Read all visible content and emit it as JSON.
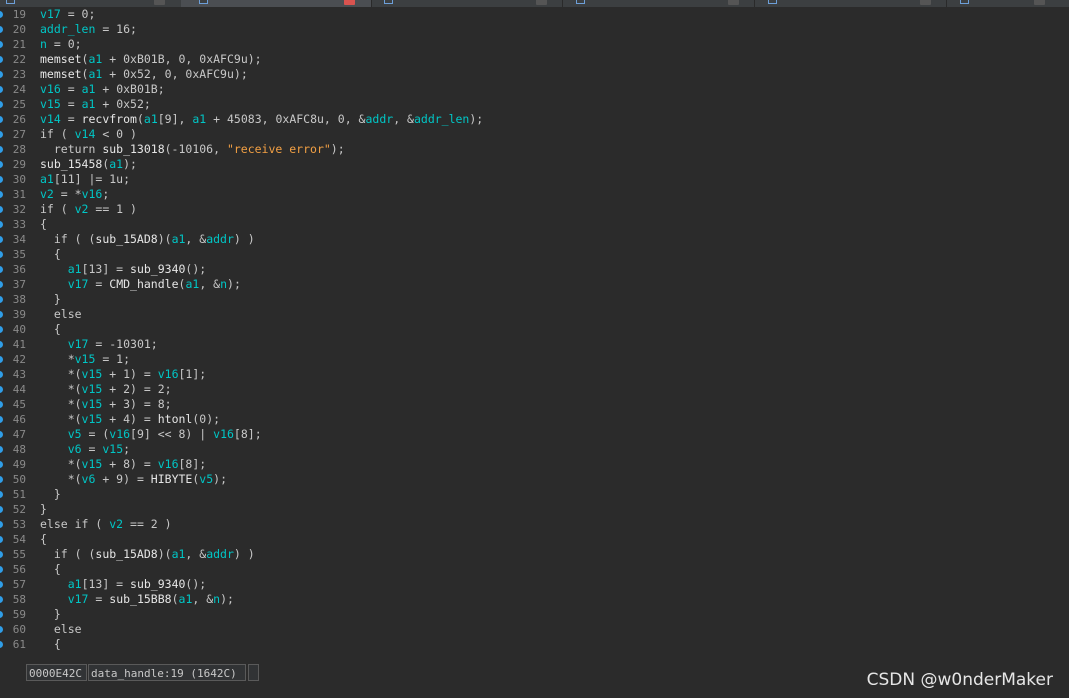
{
  "editor": {
    "lines": [
      {
        "n": "19",
        "tokens": [
          [
            "id",
            "v17"
          ],
          [
            "p",
            " = 0;"
          ]
        ]
      },
      {
        "n": "20",
        "tokens": [
          [
            "id",
            "addr_len"
          ],
          [
            "p",
            " = 16;"
          ]
        ]
      },
      {
        "n": "21",
        "tokens": [
          [
            "id",
            "n"
          ],
          [
            "p",
            " = 0;"
          ]
        ]
      },
      {
        "n": "22",
        "tokens": [
          [
            "fn",
            "memset"
          ],
          [
            "p",
            "("
          ],
          [
            "id",
            "a1"
          ],
          [
            "p",
            " + 0xB01B, 0, 0xAFC9u);"
          ]
        ]
      },
      {
        "n": "23",
        "tokens": [
          [
            "fn",
            "memset"
          ],
          [
            "p",
            "("
          ],
          [
            "id",
            "a1"
          ],
          [
            "p",
            " + 0x52, 0, 0xAFC9u);"
          ]
        ]
      },
      {
        "n": "24",
        "tokens": [
          [
            "id",
            "v16"
          ],
          [
            "p",
            " = "
          ],
          [
            "id",
            "a1"
          ],
          [
            "p",
            " + 0xB01B;"
          ]
        ]
      },
      {
        "n": "25",
        "tokens": [
          [
            "id",
            "v15"
          ],
          [
            "p",
            " = "
          ],
          [
            "id",
            "a1"
          ],
          [
            "p",
            " + 0x52;"
          ]
        ]
      },
      {
        "n": "26",
        "tokens": [
          [
            "id",
            "v14"
          ],
          [
            "p",
            " = "
          ],
          [
            "fn",
            "recvfrom"
          ],
          [
            "p",
            "("
          ],
          [
            "id",
            "a1"
          ],
          [
            "p",
            "[9], "
          ],
          [
            "id",
            "a1"
          ],
          [
            "p",
            " + 45083, 0xAFC8u, 0, &"
          ],
          [
            "id",
            "addr"
          ],
          [
            "p",
            ", &"
          ],
          [
            "id",
            "addr_len"
          ],
          [
            "p",
            ");"
          ]
        ]
      },
      {
        "n": "27",
        "tokens": [
          [
            "p",
            "if ( "
          ],
          [
            "id",
            "v14"
          ],
          [
            "p",
            " < 0 )"
          ]
        ]
      },
      {
        "n": "28",
        "tokens": [
          [
            "p",
            "  return "
          ],
          [
            "fn",
            "sub_13018"
          ],
          [
            "p",
            "(-10106, "
          ],
          [
            "str",
            "\"receive error\""
          ],
          [
            "p",
            ");"
          ]
        ]
      },
      {
        "n": "29",
        "tokens": [
          [
            "fn",
            "sub_15458"
          ],
          [
            "p",
            "("
          ],
          [
            "id",
            "a1"
          ],
          [
            "p",
            ");"
          ]
        ]
      },
      {
        "n": "30",
        "tokens": [
          [
            "id",
            "a1"
          ],
          [
            "p",
            "[11] |= 1u;"
          ]
        ]
      },
      {
        "n": "31",
        "tokens": [
          [
            "id",
            "v2"
          ],
          [
            "p",
            " = *"
          ],
          [
            "id",
            "v16"
          ],
          [
            "p",
            ";"
          ]
        ]
      },
      {
        "n": "32",
        "tokens": [
          [
            "p",
            "if ( "
          ],
          [
            "id",
            "v2"
          ],
          [
            "p",
            " == 1 )"
          ]
        ]
      },
      {
        "n": "33",
        "tokens": [
          [
            "p",
            "{"
          ]
        ]
      },
      {
        "n": "34",
        "tokens": [
          [
            "p",
            "  if ( ("
          ],
          [
            "fn",
            "sub_15AD8"
          ],
          [
            "p",
            ")("
          ],
          [
            "id",
            "a1"
          ],
          [
            "p",
            ", &"
          ],
          [
            "id",
            "addr"
          ],
          [
            "p",
            ") )"
          ]
        ]
      },
      {
        "n": "35",
        "tokens": [
          [
            "p",
            "  {"
          ]
        ]
      },
      {
        "n": "36",
        "tokens": [
          [
            "p",
            "    "
          ],
          [
            "id",
            "a1"
          ],
          [
            "p",
            "[13] = "
          ],
          [
            "fn",
            "sub_9340"
          ],
          [
            "p",
            "();"
          ]
        ]
      },
      {
        "n": "37",
        "tokens": [
          [
            "p",
            "    "
          ],
          [
            "id",
            "v17"
          ],
          [
            "p",
            " = "
          ],
          [
            "fn",
            "CMD_handle"
          ],
          [
            "p",
            "("
          ],
          [
            "id",
            "a1"
          ],
          [
            "p",
            ", &"
          ],
          [
            "id",
            "n"
          ],
          [
            "p",
            ");"
          ]
        ]
      },
      {
        "n": "38",
        "tokens": [
          [
            "p",
            "  }"
          ]
        ]
      },
      {
        "n": "39",
        "tokens": [
          [
            "p",
            "  else"
          ]
        ]
      },
      {
        "n": "40",
        "tokens": [
          [
            "p",
            "  {"
          ]
        ]
      },
      {
        "n": "41",
        "tokens": [
          [
            "p",
            "    "
          ],
          [
            "id",
            "v17"
          ],
          [
            "p",
            " = -10301;"
          ]
        ]
      },
      {
        "n": "42",
        "tokens": [
          [
            "p",
            "    *"
          ],
          [
            "id",
            "v15"
          ],
          [
            "p",
            " = 1;"
          ]
        ]
      },
      {
        "n": "43",
        "tokens": [
          [
            "p",
            "    *("
          ],
          [
            "id",
            "v15"
          ],
          [
            "p",
            " + 1) = "
          ],
          [
            "id",
            "v16"
          ],
          [
            "p",
            "[1];"
          ]
        ]
      },
      {
        "n": "44",
        "tokens": [
          [
            "p",
            "    *("
          ],
          [
            "id",
            "v15"
          ],
          [
            "p",
            " + 2) = 2;"
          ]
        ]
      },
      {
        "n": "45",
        "tokens": [
          [
            "p",
            "    *("
          ],
          [
            "id",
            "v15"
          ],
          [
            "p",
            " + 3) = 8;"
          ]
        ]
      },
      {
        "n": "46",
        "tokens": [
          [
            "p",
            "    *("
          ],
          [
            "id",
            "v15"
          ],
          [
            "p",
            " + 4) = "
          ],
          [
            "fn",
            "htonl"
          ],
          [
            "p",
            "(0);"
          ]
        ]
      },
      {
        "n": "47",
        "tokens": [
          [
            "p",
            "    "
          ],
          [
            "id",
            "v5"
          ],
          [
            "p",
            " = ("
          ],
          [
            "id",
            "v16"
          ],
          [
            "p",
            "[9] << 8) | "
          ],
          [
            "id",
            "v16"
          ],
          [
            "p",
            "[8];"
          ]
        ]
      },
      {
        "n": "48",
        "tokens": [
          [
            "p",
            "    "
          ],
          [
            "id",
            "v6"
          ],
          [
            "p",
            " = "
          ],
          [
            "id",
            "v15"
          ],
          [
            "p",
            ";"
          ]
        ]
      },
      {
        "n": "49",
        "tokens": [
          [
            "p",
            "    *("
          ],
          [
            "id",
            "v15"
          ],
          [
            "p",
            " + 8) = "
          ],
          [
            "id",
            "v16"
          ],
          [
            "p",
            "[8];"
          ]
        ]
      },
      {
        "n": "50",
        "tokens": [
          [
            "p",
            "    *("
          ],
          [
            "id",
            "v6"
          ],
          [
            "p",
            " + 9) = "
          ],
          [
            "fn",
            "HIBYTE"
          ],
          [
            "p",
            "("
          ],
          [
            "id",
            "v5"
          ],
          [
            "p",
            ");"
          ]
        ]
      },
      {
        "n": "51",
        "tokens": [
          [
            "p",
            "  }"
          ]
        ]
      },
      {
        "n": "52",
        "tokens": [
          [
            "p",
            "}"
          ]
        ]
      },
      {
        "n": "53",
        "tokens": [
          [
            "p",
            "else if ( "
          ],
          [
            "id",
            "v2"
          ],
          [
            "p",
            " == 2 )"
          ]
        ]
      },
      {
        "n": "54",
        "tokens": [
          [
            "p",
            "{"
          ]
        ]
      },
      {
        "n": "55",
        "tokens": [
          [
            "p",
            "  if ( ("
          ],
          [
            "fn",
            "sub_15AD8"
          ],
          [
            "p",
            ")("
          ],
          [
            "id",
            "a1"
          ],
          [
            "p",
            ", &"
          ],
          [
            "id",
            "addr"
          ],
          [
            "p",
            ") )"
          ]
        ]
      },
      {
        "n": "56",
        "tokens": [
          [
            "p",
            "  {"
          ]
        ]
      },
      {
        "n": "57",
        "tokens": [
          [
            "p",
            "    "
          ],
          [
            "id",
            "a1"
          ],
          [
            "p",
            "[13] = "
          ],
          [
            "fn",
            "sub_9340"
          ],
          [
            "p",
            "();"
          ]
        ]
      },
      {
        "n": "58",
        "tokens": [
          [
            "p",
            "    "
          ],
          [
            "id",
            "v17"
          ],
          [
            "p",
            " = "
          ],
          [
            "fn",
            "sub_15BB8"
          ],
          [
            "p",
            "("
          ],
          [
            "id",
            "a1"
          ],
          [
            "p",
            ", &"
          ],
          [
            "id",
            "n"
          ],
          [
            "p",
            ");"
          ]
        ]
      },
      {
        "n": "59",
        "tokens": [
          [
            "p",
            "  }"
          ]
        ]
      },
      {
        "n": "60",
        "tokens": [
          [
            "p",
            "  else"
          ]
        ]
      },
      {
        "n": "61",
        "tokens": [
          [
            "p",
            "  {"
          ]
        ]
      }
    ]
  },
  "status": {
    "address": "0000E42C",
    "location": "data_handle:19 (1642C)",
    "extra": ""
  },
  "watermark": "CSDN @w0nderMaker",
  "colors": {
    "identifier": "#00c6c6",
    "string": "#f2a044",
    "breakpoint": "#2f9ee8",
    "background": "#2b2b2b"
  },
  "icons": {
    "breakpoint": "breakpoint-dot-icon",
    "tab": "document-tab-icon",
    "close": "close-icon"
  }
}
